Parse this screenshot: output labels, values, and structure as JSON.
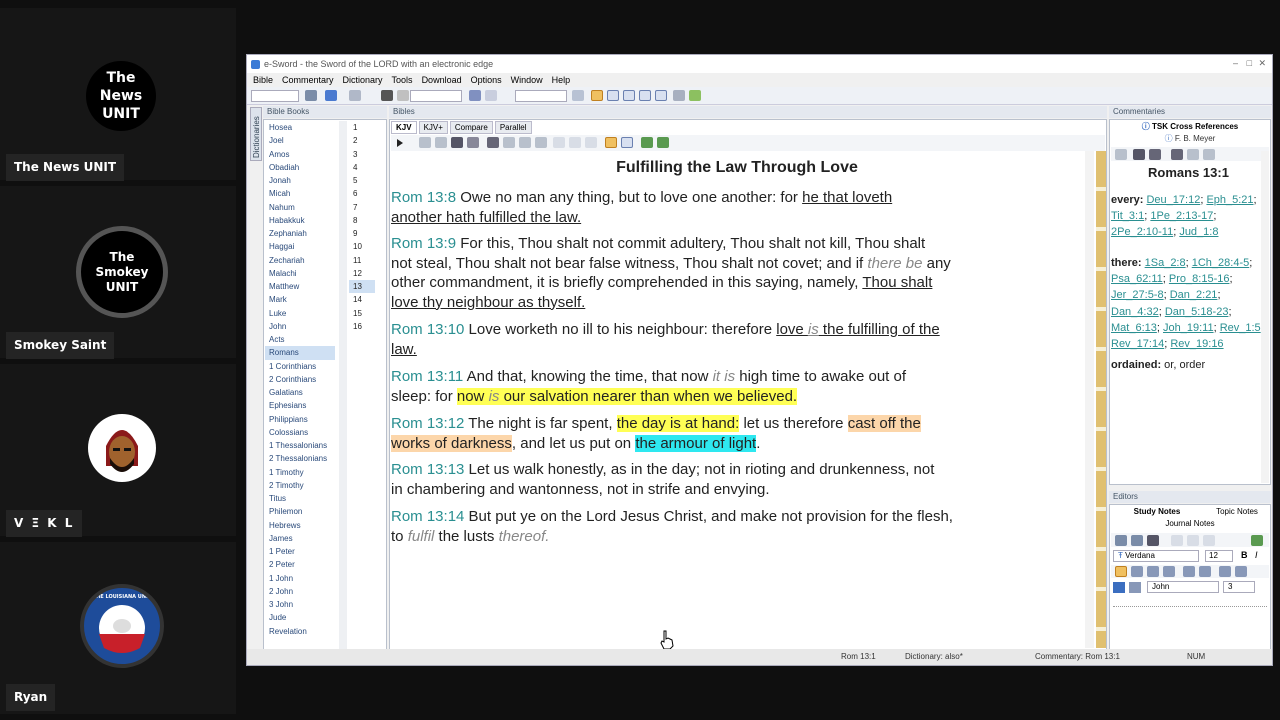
{
  "participants": [
    {
      "name": "The News UNIT",
      "logo": "The\nNews\nUNIT"
    },
    {
      "name": "Smokey Saint",
      "logo": "The\nSmokey\nUNIT"
    },
    {
      "name": "V Ξ K L"
    },
    {
      "name": "Ryan",
      "logo": "THE LOUISIANA UNIT"
    }
  ],
  "app": {
    "title": "e-Sword - the Sword of the LORD with an electronic edge",
    "menu": [
      "Bible",
      "Commentary",
      "Dictionary",
      "Tools",
      "Download",
      "Options",
      "Window",
      "Help"
    ]
  },
  "panels": {
    "books_header": "Bible Books",
    "bibles_header": "Bibles",
    "commentaries_header": "Commentaries",
    "editors_header": "Editors",
    "dictionaries_tab": "Dictionaries"
  },
  "books": [
    "Hosea",
    "Joel",
    "Amos",
    "Obadiah",
    "Jonah",
    "Micah",
    "Nahum",
    "Habakkuk",
    "Zephaniah",
    "Haggai",
    "Zechariah",
    "Malachi",
    "Matthew",
    "Mark",
    "Luke",
    "John",
    "Acts",
    "Romans",
    "1 Corinthians",
    "2 Corinthians",
    "Galatians",
    "Ephesians",
    "Philippians",
    "Colossians",
    "1 Thessalonians",
    "2 Thessalonians",
    "1 Timothy",
    "2 Timothy",
    "Titus",
    "Philemon",
    "Hebrews",
    "James",
    "1 Peter",
    "2 Peter",
    "1 John",
    "2 John",
    "3 John",
    "Jude",
    "Revelation"
  ],
  "selected_book": "Romans",
  "chapters": [
    "1",
    "2",
    "3",
    "4",
    "5",
    "6",
    "7",
    "8",
    "9",
    "10",
    "11",
    "12",
    "13",
    "14",
    "15",
    "16"
  ],
  "selected_chapter": "13",
  "bible_tabs": [
    "KJV",
    "KJV+",
    "Compare",
    "Parallel"
  ],
  "heading": "Fulfilling the Law Through Love",
  "verses": {
    "v8": {
      "ref": "Rom 13:8",
      "a": " Owe no man any thing, but to love one another: for ",
      "b": "he that loveth",
      "c": "another hath fulfilled the law."
    },
    "v9": {
      "ref": "Rom 13:9",
      "a": " For this, Thou shalt not commit adultery, Thou shalt not kill, Thou shalt",
      "b": "not steal, Thou shalt not bear false witness, Thou shalt not covet; and if ",
      "c": "there be",
      "d": " any",
      "e": "other commandment, it is briefly comprehended in this saying, namely, ",
      "f": "Thou shalt",
      "g": "love thy neighbour as thyself."
    },
    "v10": {
      "ref": "Rom 13:10",
      "a": " Love worketh no ill to his neighbour: therefore ",
      "b": "love ",
      "c": "is",
      "d": " the fulfilling of the",
      "e": "law."
    },
    "v11": {
      "ref": "Rom 13:11",
      "a": " And that, knowing the time, that now ",
      "b": "it is",
      "c": " high time to awake out of",
      "d": "sleep: for ",
      "e": "now ",
      "f": "is",
      "g": " our salvation nearer than when we believed."
    },
    "v12": {
      "ref": "Rom 13:12",
      "a": " The night is far spent, ",
      "b": "the day is at hand:",
      "c": " let us therefore ",
      "d": "cast off the",
      "e": "works of darkness",
      "f": ", and let us put on ",
      "g": "the armour of light",
      "h": "."
    },
    "v13": {
      "ref": "Rom 13:13",
      "a": " Let us walk honestly, as in the day; not in rioting and drunkenness, not",
      "b": "in chambering and wantonness, not in strife and envying."
    },
    "v14": {
      "ref": "Rom 13:14",
      "a": " But put ye on the Lord Jesus Christ, and make not provision for the flesh,",
      "b": "to ",
      "c": "fulfil",
      "d": " the lusts ",
      "e": "thereof."
    }
  },
  "commentary": {
    "tab1": "TSK Cross References",
    "tab2": "F. B. Meyer",
    "title": "Romans 13:1",
    "every_label": "every:",
    "every_links": [
      "Deu_17:12",
      "Eph_5:21",
      "Tit_3:1",
      "1Pe_2:13-17",
      "2Pe_2:10-11",
      "Jud_1:8"
    ],
    "there_label": "there:",
    "there_links": [
      "1Sa_2:8",
      "1Ch_28:4-5",
      "Psa_62:11",
      "Pro_8:15-16",
      "Jer_27:5-8",
      "Dan_2:21",
      "Dan_4:32",
      "Dan_5:18-23",
      "Mat_6:13",
      "Joh_19:11",
      "Rev_1:5",
      "Rev_17:14",
      "Rev_19:16"
    ],
    "ordained": "ordained:",
    "ordained_text": " or, order"
  },
  "editors": {
    "tab1": "Study Notes",
    "tab2": "Topic Notes",
    "tab3": "Journal Notes",
    "font": "Verdana",
    "size": "12",
    "book": "John",
    "chapter": "3"
  },
  "status": {
    "ref": "Rom 13:1",
    "dictionary": "Dictionary: also*",
    "commentary": "Commentary: Rom 13:1",
    "num": "NUM"
  }
}
